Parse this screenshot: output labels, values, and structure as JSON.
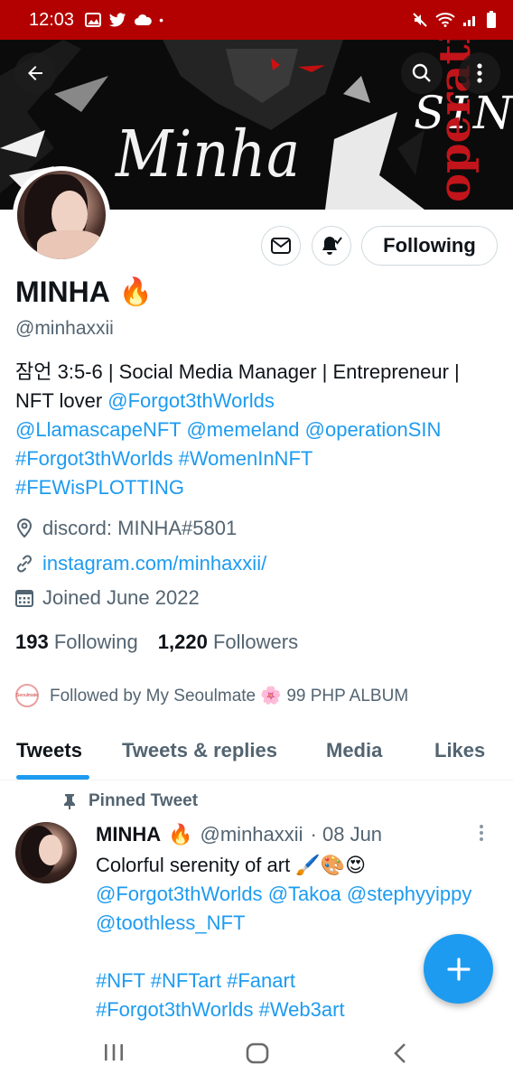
{
  "status_bar": {
    "time": "12:03",
    "left_icons": [
      "image-icon",
      "twitter-icon",
      "cloud-icon",
      "dot-icon"
    ],
    "right_icons": [
      "mute-icon",
      "wifi-icon",
      "signal-icon",
      "battery-icon"
    ],
    "color": "#b30000"
  },
  "banner": {
    "art_text_left": "Minha",
    "art_text_sin": "SIN",
    "art_text_operation": "operation"
  },
  "profile": {
    "display_name": "MINHA",
    "name_emoji": "🔥",
    "handle": "@minhaxxii",
    "bio_plain_1": "잠언 3:5-6 | Social Media Manager | Entrepreneur | NFT lover ",
    "bio_links": [
      "@Forgot3thWorlds",
      "@LlamascapeNFT",
      "@memeland",
      "@operationSIN",
      "#Forgot3thWorlds",
      "#WomenInNFT",
      "#FEWisPLOTTING"
    ],
    "location": "discord: MINHA#5801",
    "url": "instagram.com/minhaxxii/",
    "joined": "Joined June 2022",
    "following_count": "193",
    "following_label": "Following",
    "followers_count": "1,220",
    "followers_label": "Followers",
    "followed_by": "Followed by My Seoulmate 🌸 99 PHP ALBUM",
    "mini_avatar_text": "Seoulmate"
  },
  "buttons": {
    "following": "Following"
  },
  "tabs": [
    {
      "label": "Tweets",
      "active": true
    },
    {
      "label": "Tweets & replies",
      "active": false
    },
    {
      "label": "Media",
      "active": false
    },
    {
      "label": "Likes",
      "active": false
    }
  ],
  "pinned_tweet": {
    "pinned_label": "Pinned Tweet",
    "name": "MINHA",
    "name_emoji": "🔥",
    "handle": "@minhaxxii",
    "date": "· 08 Jun",
    "text": "Colorful serenity of art 🖌️🎨😍",
    "mentions": [
      "@Forgot3thWorlds",
      "@Takoa",
      "@stephyyippy",
      "@toothless_NFT"
    ],
    "hashtags_line1": [
      "#NFT",
      "#NFTart",
      "#Fanart"
    ],
    "hashtags_line2": [
      "#Forgot3thWorlds",
      "#Web3art"
    ]
  },
  "colors": {
    "accent": "#1d9bf0",
    "text": "#0f1419",
    "secondary": "#536471"
  }
}
